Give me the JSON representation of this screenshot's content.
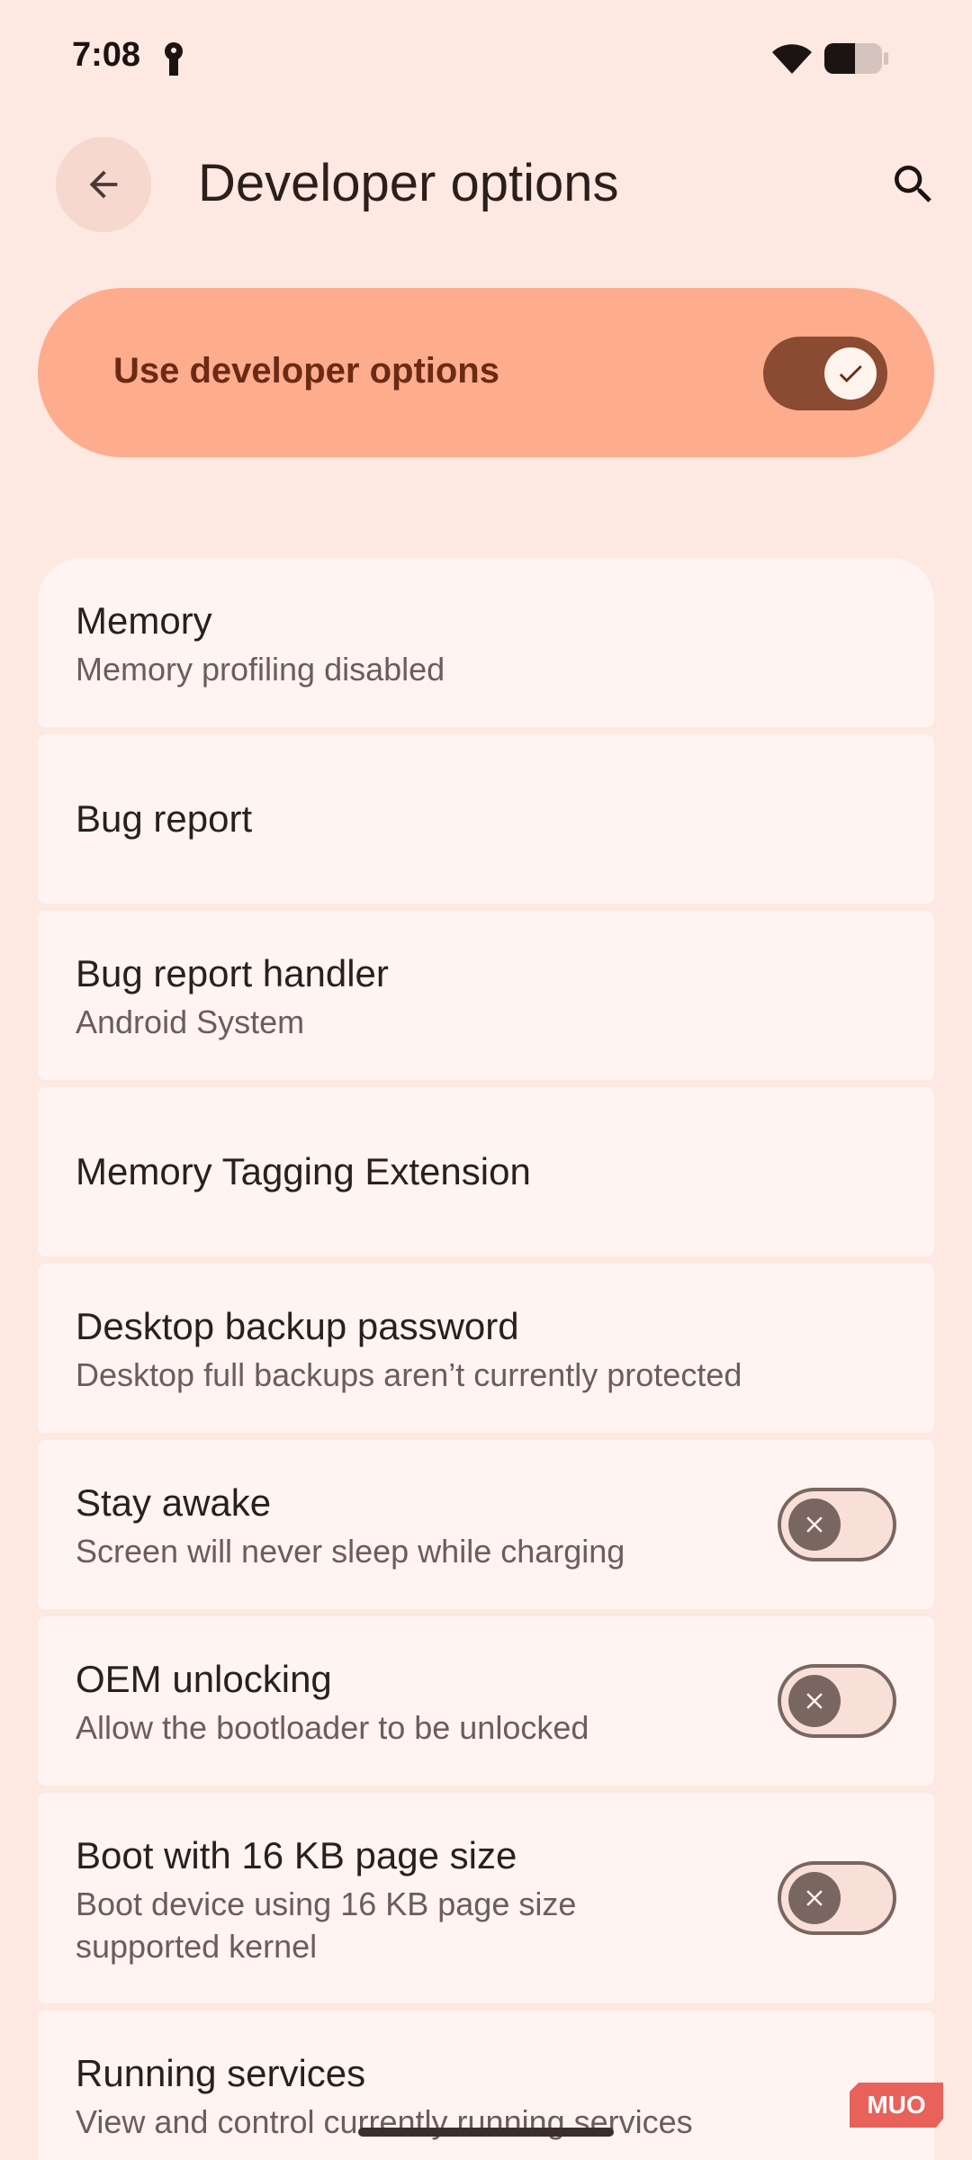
{
  "status_bar": {
    "time": "7:08"
  },
  "header": {
    "title": "Developer options"
  },
  "master_switch": {
    "label": "Use developer options",
    "on": true
  },
  "settings": [
    {
      "title": "Memory",
      "subtitle": "Memory profiling disabled"
    },
    {
      "title": "Bug report"
    },
    {
      "title": "Bug report handler",
      "subtitle": "Android System"
    },
    {
      "title": "Memory Tagging Extension"
    },
    {
      "title": "Desktop backup password",
      "subtitle": "Desktop full backups aren’t currently protected"
    },
    {
      "title": "Stay awake",
      "subtitle": "Screen will never sleep while charging",
      "toggle": false
    },
    {
      "title": "OEM unlocking",
      "subtitle": "Allow the bootloader to be unlocked",
      "toggle": false
    },
    {
      "title": "Boot with 16 KB page size",
      "subtitle": "Boot device using 16 KB page size\nsupported kernel",
      "toggle": false
    },
    {
      "title": "Running services",
      "subtitle": "View and control currently running services"
    }
  ],
  "watermark": {
    "text": "MUO"
  },
  "colors": {
    "background": "#FDE8E2",
    "master_bg": "#FDAD8E",
    "master_text": "#6B2A14",
    "card_bg": "#FFF4F1",
    "toggle_on": "#8B4A32"
  },
  "icons": {
    "back": "arrow-back-icon",
    "search": "search-icon",
    "check": "check-icon",
    "close": "close-icon",
    "wifi": "wifi-icon",
    "battery": "battery-icon",
    "key": "vpn-key-icon"
  }
}
